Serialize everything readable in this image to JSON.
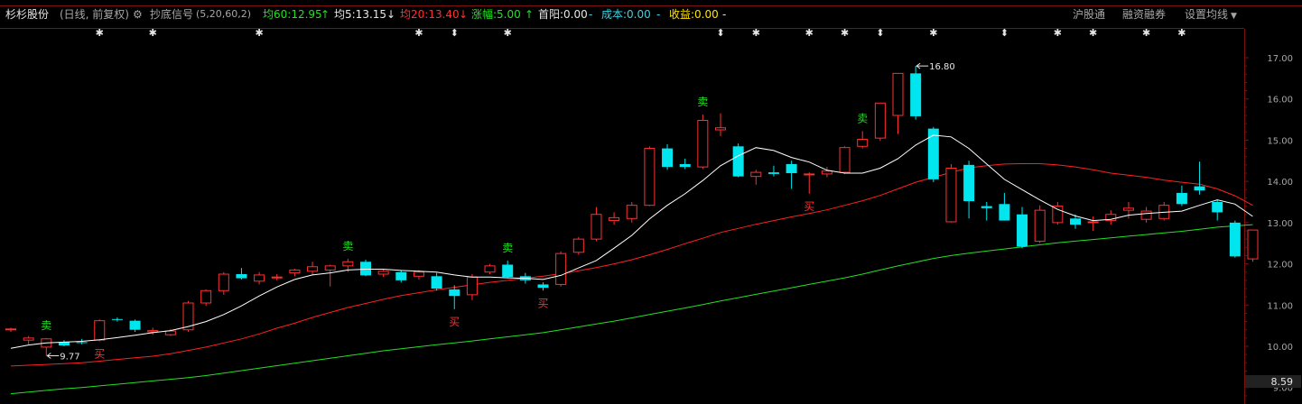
{
  "header": {
    "stock_name": "杉杉股份",
    "mode": "(日线, 前复权)",
    "indicator": "抄底信号",
    "indicator_params": "(5,20,60,2)",
    "ma60_label": "均60:12.95",
    "ma60_arrow": "↑",
    "ma5_label": "均5:13.15",
    "ma5_arrow": "↓",
    "ma20_label": "均20:13.40",
    "ma20_arrow": "↓",
    "change_label": "涨幅:5.00",
    "change_arrow": "↑",
    "first_yang": "首阳:0.00",
    "dash1": "-",
    "cost": "成本:0.00",
    "dash2": "-",
    "profit": "收益:0.00",
    "dash3": "-",
    "btn_hgt": "沪股通",
    "btn_rzrq": "融资融券",
    "btn_ma": "设置均线"
  },
  "colors": {
    "up": "#ff3030",
    "down": "#00e5ee",
    "ma5": "#ffffff",
    "ma20": "#ff2020",
    "ma60": "#22e022",
    "buy": "#ff3030",
    "sell": "#22e022",
    "grid": "#7a1010",
    "axis_text": "#a6a6a6"
  },
  "chart_data": {
    "type": "candlestick",
    "y_ticks": [
      "17.00",
      "16.00",
      "15.00",
      "14.00",
      "13.00",
      "12.00",
      "11.00",
      "10.00",
      "9.00"
    ],
    "y_ticks_values": [
      17,
      16,
      15,
      14,
      13,
      12,
      11,
      10,
      9
    ],
    "ylim": [
      8.6,
      17.7
    ],
    "current_price": "8.59",
    "max_label": "16.80",
    "min_label": "9.77",
    "candles": [
      [
        10.4,
        10.45,
        10.35,
        10.42
      ],
      [
        10.15,
        10.25,
        10.05,
        10.2
      ],
      [
        9.98,
        10.2,
        9.77,
        10.18
      ],
      [
        10.1,
        10.15,
        10.0,
        10.02
      ],
      [
        10.1,
        10.18,
        10.05,
        10.08
      ],
      [
        10.15,
        10.65,
        10.12,
        10.62
      ],
      [
        10.66,
        10.7,
        10.6,
        10.64
      ],
      [
        10.62,
        10.65,
        10.35,
        10.4
      ],
      [
        10.35,
        10.45,
        10.28,
        10.38
      ],
      [
        10.28,
        10.42,
        10.25,
        10.37
      ],
      [
        10.4,
        11.1,
        10.35,
        11.05
      ],
      [
        11.05,
        11.38,
        10.98,
        11.35
      ],
      [
        11.35,
        11.8,
        11.25,
        11.75
      ],
      [
        11.75,
        11.9,
        11.62,
        11.65
      ],
      [
        11.58,
        11.8,
        11.5,
        11.73
      ],
      [
        11.68,
        11.75,
        11.6,
        11.68
      ],
      [
        11.78,
        11.88,
        11.7,
        11.85
      ],
      [
        11.82,
        12.05,
        11.72,
        11.93
      ],
      [
        11.85,
        11.98,
        11.45,
        11.95
      ],
      [
        11.95,
        12.12,
        11.8,
        12.05
      ],
      [
        12.05,
        12.1,
        11.7,
        11.72
      ],
      [
        11.75,
        11.88,
        11.68,
        11.82
      ],
      [
        11.8,
        11.85,
        11.55,
        11.6
      ],
      [
        11.7,
        11.85,
        11.62,
        11.8
      ],
      [
        11.7,
        11.78,
        11.35,
        11.4
      ],
      [
        11.38,
        11.48,
        10.9,
        11.22
      ],
      [
        11.25,
        11.75,
        11.12,
        11.68
      ],
      [
        11.8,
        12.0,
        11.75,
        11.95
      ],
      [
        11.98,
        12.08,
        11.65,
        11.68
      ],
      [
        11.7,
        11.78,
        11.52,
        11.6
      ],
      [
        11.5,
        11.55,
        11.35,
        11.42
      ],
      [
        11.5,
        12.3,
        11.45,
        12.25
      ],
      [
        12.28,
        12.65,
        12.22,
        12.6
      ],
      [
        12.6,
        13.38,
        12.55,
        13.2
      ],
      [
        13.05,
        13.25,
        12.95,
        13.12
      ],
      [
        13.1,
        13.5,
        13.0,
        13.42
      ],
      [
        13.42,
        14.85,
        13.4,
        14.8
      ],
      [
        14.8,
        14.9,
        14.28,
        14.35
      ],
      [
        14.42,
        14.55,
        14.3,
        14.35
      ],
      [
        14.35,
        15.62,
        14.3,
        15.48
      ],
      [
        15.25,
        15.65,
        15.1,
        15.3
      ],
      [
        14.85,
        14.92,
        14.1,
        14.12
      ],
      [
        14.12,
        14.28,
        13.92,
        14.22
      ],
      [
        14.22,
        14.38,
        14.12,
        14.18
      ],
      [
        14.42,
        14.5,
        13.82,
        14.2
      ],
      [
        14.18,
        14.22,
        13.7,
        14.18
      ],
      [
        14.18,
        14.35,
        14.1,
        14.25
      ],
      [
        14.22,
        14.85,
        14.18,
        14.82
      ],
      [
        14.85,
        15.22,
        14.8,
        15.02
      ],
      [
        15.05,
        15.52,
        14.98,
        15.9
      ],
      [
        15.6,
        16.25,
        15.15,
        16.62
      ],
      [
        16.62,
        16.8,
        15.5,
        15.58
      ],
      [
        15.28,
        15.32,
        13.98,
        14.05
      ],
      [
        13.02,
        14.42,
        13.0,
        14.32
      ],
      [
        14.4,
        14.5,
        13.1,
        13.52
      ],
      [
        13.4,
        13.5,
        13.05,
        13.35
      ],
      [
        13.45,
        13.72,
        13.05,
        13.05
      ],
      [
        13.2,
        13.38,
        12.38,
        12.42
      ],
      [
        12.55,
        13.42,
        12.5,
        13.3
      ],
      [
        13.0,
        13.5,
        12.95,
        13.4
      ],
      [
        13.1,
        13.2,
        12.85,
        12.95
      ],
      [
        13.0,
        13.15,
        12.8,
        13.02
      ],
      [
        13.05,
        13.3,
        12.95,
        13.2
      ],
      [
        13.3,
        13.5,
        13.1,
        13.35
      ],
      [
        13.08,
        13.38,
        13.0,
        13.28
      ],
      [
        13.1,
        13.5,
        13.05,
        13.42
      ],
      [
        13.72,
        13.9,
        13.4,
        13.45
      ],
      [
        13.88,
        14.48,
        13.68,
        13.78
      ],
      [
        13.5,
        13.55,
        13.05,
        13.25
      ],
      [
        13.0,
        13.05,
        12.15,
        12.18
      ],
      [
        12.12,
        12.82,
        12.05,
        12.82
      ]
    ],
    "ma5": [
      9.95,
      10.03,
      10.08,
      10.1,
      10.12,
      10.16,
      10.21,
      10.27,
      10.33,
      10.38,
      10.48,
      10.6,
      10.77,
      10.98,
      11.22,
      11.44,
      11.62,
      11.73,
      11.78,
      11.85,
      11.87,
      11.87,
      11.84,
      11.82,
      11.8,
      11.73,
      11.68,
      11.68,
      11.66,
      11.65,
      11.62,
      11.72,
      11.9,
      12.08,
      12.38,
      12.69,
      13.09,
      13.42,
      13.7,
      14.02,
      14.38,
      14.62,
      14.82,
      14.75,
      14.58,
      14.47,
      14.27,
      14.2,
      14.2,
      14.32,
      14.55,
      14.88,
      15.12,
      15.08,
      14.8,
      14.42,
      14.05,
      13.8,
      13.55,
      13.32,
      13.16,
      13.05,
      13.08,
      13.18,
      13.22,
      13.25,
      13.28,
      13.42,
      13.55,
      13.45,
      13.15
    ],
    "ma20": [
      9.52,
      9.54,
      9.56,
      9.58,
      9.6,
      9.64,
      9.68,
      9.72,
      9.76,
      9.82,
      9.9,
      9.98,
      10.08,
      10.18,
      10.3,
      10.44,
      10.56,
      10.7,
      10.82,
      10.94,
      11.04,
      11.14,
      11.23,
      11.3,
      11.37,
      11.43,
      11.49,
      11.55,
      11.6,
      11.65,
      11.7,
      11.76,
      11.83,
      11.91,
      12.0,
      12.1,
      12.22,
      12.35,
      12.49,
      12.62,
      12.76,
      12.86,
      12.96,
      13.05,
      13.14,
      13.22,
      13.31,
      13.42,
      13.53,
      13.66,
      13.82,
      13.98,
      14.1,
      14.22,
      14.33,
      14.38,
      14.42,
      14.43,
      14.43,
      14.4,
      14.35,
      14.28,
      14.2,
      14.15,
      14.1,
      14.03,
      13.98,
      13.93,
      13.82,
      13.65,
      13.42
    ],
    "ma60": [
      8.85,
      8.89,
      8.93,
      8.97,
      9.0,
      9.04,
      9.08,
      9.12,
      9.16,
      9.2,
      9.24,
      9.29,
      9.35,
      9.41,
      9.47,
      9.53,
      9.59,
      9.65,
      9.71,
      9.77,
      9.83,
      9.89,
      9.94,
      9.99,
      10.04,
      10.08,
      10.13,
      10.18,
      10.23,
      10.28,
      10.33,
      10.4,
      10.47,
      10.54,
      10.61,
      10.69,
      10.77,
      10.85,
      10.93,
      11.01,
      11.1,
      11.18,
      11.26,
      11.34,
      11.42,
      11.5,
      11.58,
      11.66,
      11.75,
      11.85,
      11.95,
      12.04,
      12.13,
      12.2,
      12.26,
      12.31,
      12.36,
      12.41,
      12.46,
      12.51,
      12.55,
      12.59,
      12.63,
      12.67,
      12.71,
      12.75,
      12.79,
      12.84,
      12.89,
      12.92,
      12.95
    ],
    "signals": [
      {
        "i": 2,
        "type": "sell",
        "text": "卖"
      },
      {
        "i": 5,
        "type": "buy",
        "text": "买"
      },
      {
        "i": 19,
        "type": "sell",
        "text": "卖"
      },
      {
        "i": 25,
        "type": "buy",
        "text": "买"
      },
      {
        "i": 28,
        "type": "sell",
        "text": "卖"
      },
      {
        "i": 30,
        "type": "buy",
        "text": "买"
      },
      {
        "i": 39,
        "type": "sell",
        "text": "卖"
      },
      {
        "i": 45,
        "type": "buy",
        "text": "买"
      },
      {
        "i": 48,
        "type": "sell",
        "text": "卖"
      }
    ],
    "markers": [
      {
        "i": 5,
        "glyph": "✱"
      },
      {
        "i": 8,
        "glyph": "✱"
      },
      {
        "i": 14,
        "glyph": "✱"
      },
      {
        "i": 23,
        "glyph": "✱"
      },
      {
        "i": 25,
        "glyph": "⬍"
      },
      {
        "i": 28,
        "glyph": "✱"
      },
      {
        "i": 40,
        "glyph": "⬍"
      },
      {
        "i": 42,
        "glyph": "✱"
      },
      {
        "i": 45,
        "glyph": "✱"
      },
      {
        "i": 47,
        "glyph": "✱"
      },
      {
        "i": 49,
        "glyph": "⬍"
      },
      {
        "i": 52,
        "glyph": "✱"
      },
      {
        "i": 56,
        "glyph": "⬍"
      },
      {
        "i": 59,
        "glyph": "✱"
      },
      {
        "i": 61,
        "glyph": "✱"
      },
      {
        "i": 64,
        "glyph": "✱"
      },
      {
        "i": 66,
        "glyph": "✱"
      }
    ]
  }
}
